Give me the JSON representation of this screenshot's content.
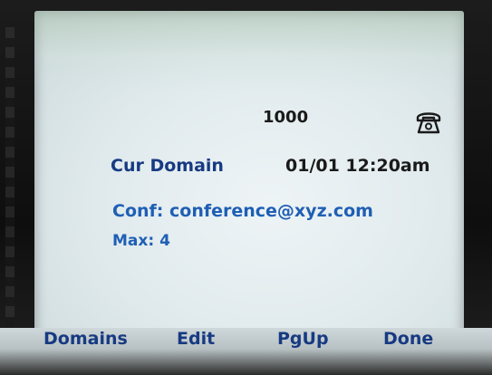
{
  "status": {
    "extension": "1000",
    "line_icon": "phone-icon"
  },
  "header": {
    "domain_label": "Cur Domain",
    "datetime": "01/01 12:20am"
  },
  "details": {
    "conference": "Conf: conference@xyz.com",
    "max": "Max: 4"
  },
  "softkeys": [
    {
      "label": "Domains"
    },
    {
      "label": "Edit"
    },
    {
      "label": "PgUp"
    },
    {
      "label": "Done"
    }
  ],
  "colors": {
    "screen_background": "#dfe9ec",
    "label_blue": "#173a82",
    "value_blue": "#1f5fb4",
    "text_dark": "#1a1a1a"
  }
}
